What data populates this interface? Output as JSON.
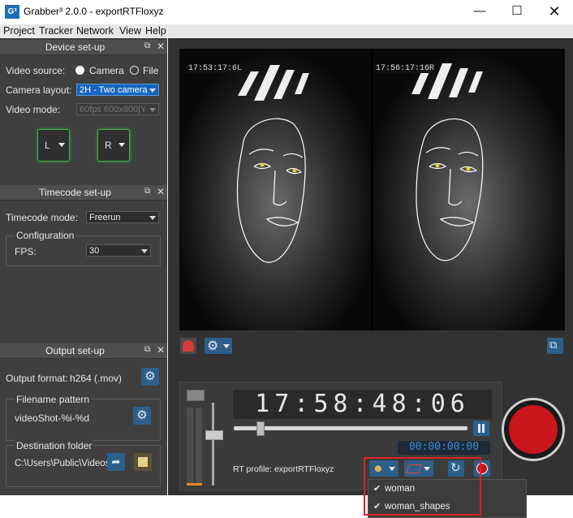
{
  "window": {
    "title": "Grabber³ 2.0.0 - exportRTFloxyz",
    "app_icon": "G³",
    "controls": [
      "minimize",
      "maximize",
      "close"
    ]
  },
  "menu": [
    "Project",
    "Tracker",
    "Network",
    "View",
    "Help"
  ],
  "device_setup": {
    "title": "Device set-up",
    "video_source_label": "Video source:",
    "source_options": [
      "Camera",
      "File"
    ],
    "selected_source": "Camera",
    "camera_layout_label": "Camera layout:",
    "camera_layout_value": "2H - Two camera",
    "video_mode_label": "Video mode:",
    "video_mode_value": "60fps 600x800|Y",
    "cam_left": "L",
    "cam_right": "R"
  },
  "timecode_setup": {
    "title": "Timecode set-up",
    "mode_label": "Timecode mode:",
    "mode_value": "Freerun",
    "config_label": "Configuration",
    "fps_label": "FPS:",
    "fps_value": "30"
  },
  "output_setup": {
    "title": "Output set-up",
    "format_label": "Output format:",
    "format_value": "h264 (.mov)",
    "filename_label": "Filename pattern",
    "filename_value": "videoShot-%i-%d",
    "dest_label": "Destination folder",
    "dest_value": "C:\\Users\\Public\\Videos"
  },
  "video": {
    "tc_left": "17:53:17:6L",
    "tc_right": "17:56:17:16R"
  },
  "recorder": {
    "timecode": "17:58:48:06",
    "elapsed": "00:00:00:00",
    "rt_profile": "RT profile: exportRTFloxyz",
    "playhead_fraction": 0.11
  },
  "dropdown_items": [
    "woman",
    "woman_shapes"
  ],
  "colors": {
    "record": "#c8161c",
    "accent": "#2e5f8a",
    "highlight": "#d22222"
  }
}
